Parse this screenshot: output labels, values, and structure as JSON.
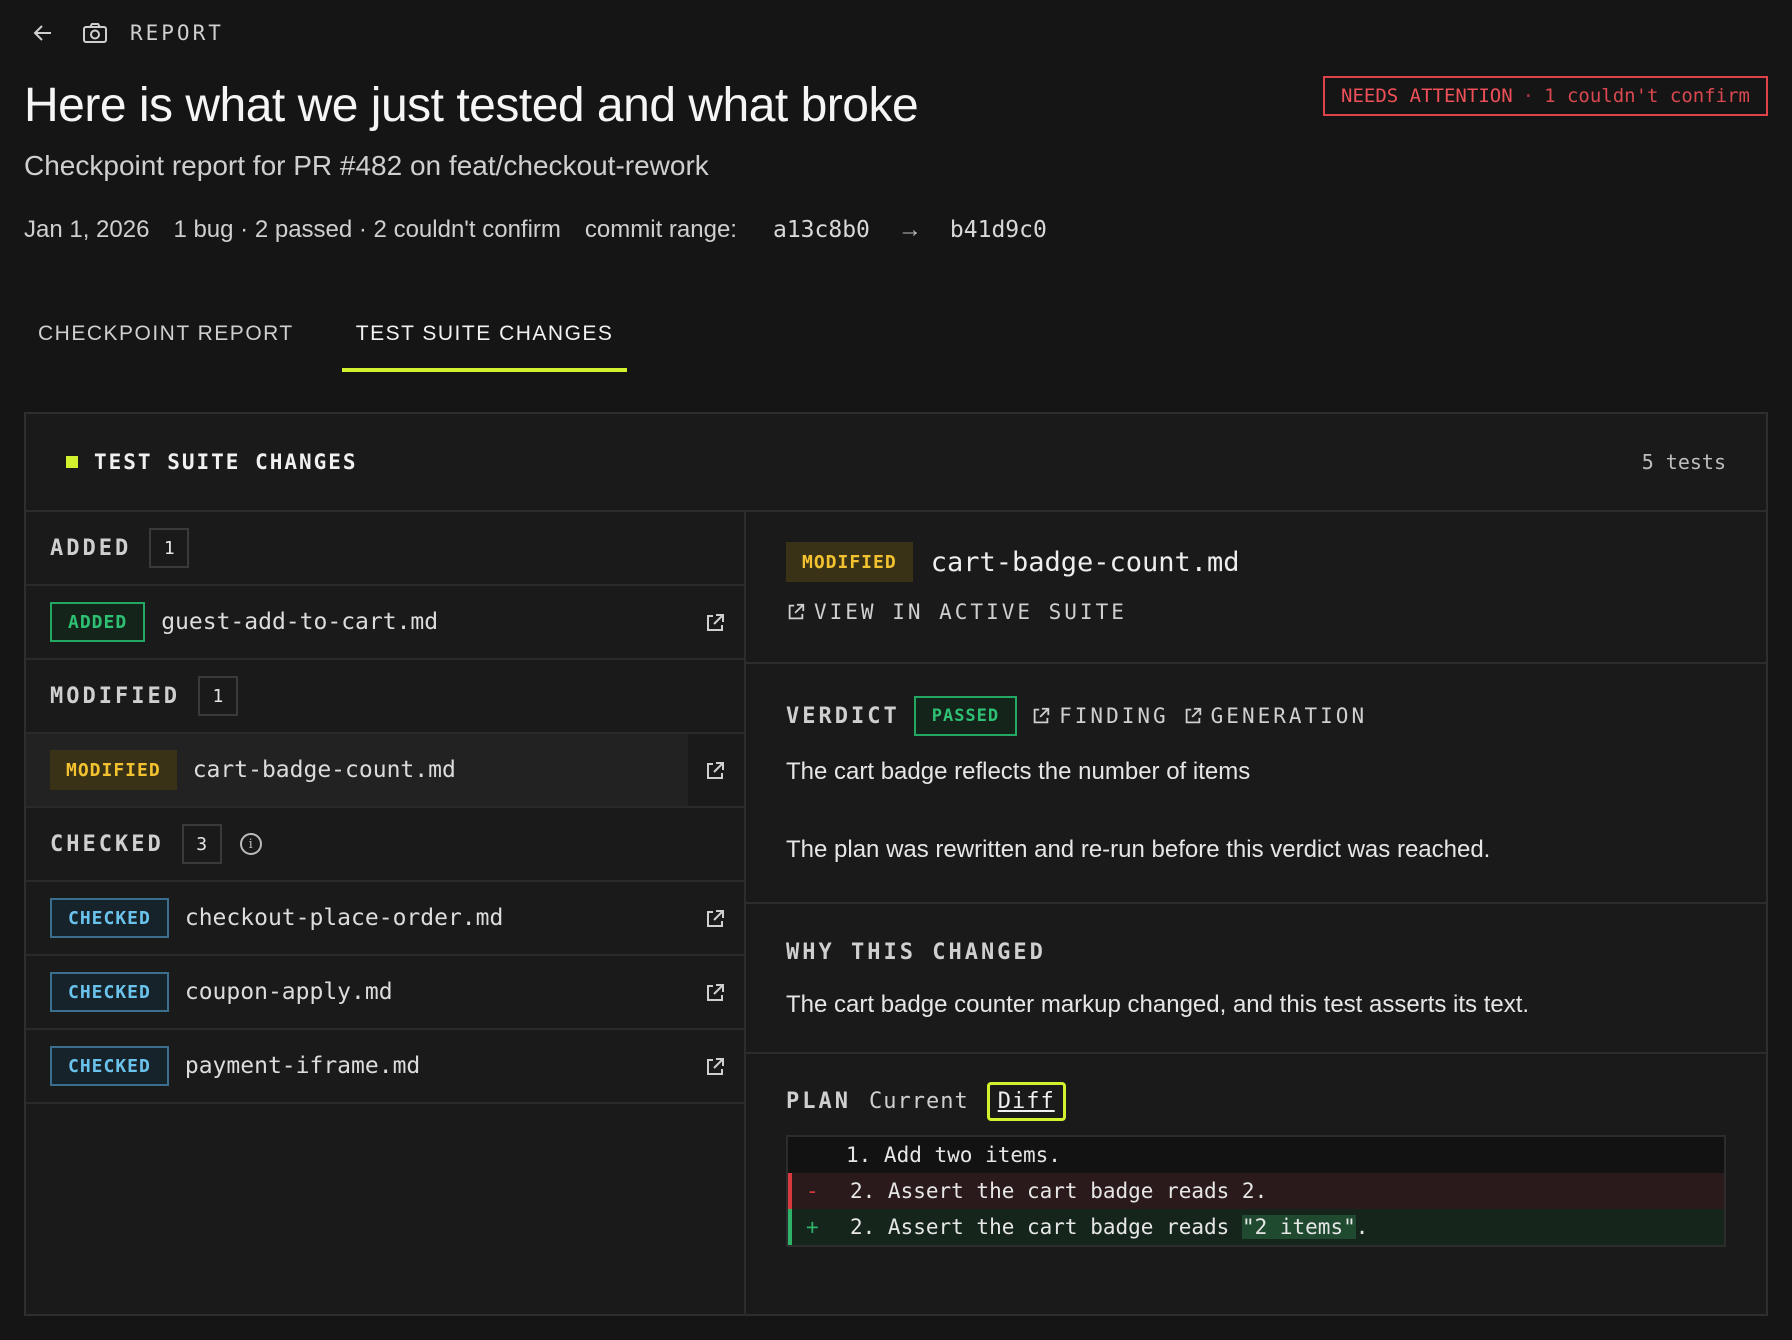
{
  "topbar": {
    "label": "REPORT"
  },
  "header": {
    "title": "Here is what we just tested and what broke",
    "subtitle": "Checkpoint report for PR #482 on feat/checkout-rework",
    "date": "Jan 1, 2026",
    "summary": "1 bug · 2 passed · 2 couldn't confirm",
    "commit_label": "commit range:",
    "commit_from": "a13c8b0",
    "commit_arrow": "→",
    "commit_to": "b41d9c0",
    "status": {
      "label": "NEEDS ATTENTION",
      "sep": "·",
      "detail": "1 couldn't confirm",
      "color": "#e0424a"
    }
  },
  "tabs": [
    {
      "label": "CHECKPOINT REPORT",
      "active": false
    },
    {
      "label": "TEST SUITE CHANGES",
      "active": true
    }
  ],
  "accent": "#d3f22e",
  "panel": {
    "title": "TEST SUITE CHANGES",
    "count": "5 tests",
    "groups": [
      {
        "label": "ADDED",
        "count": "1",
        "items": [
          {
            "badge": "ADDED",
            "name": "guest-add-to-cart.md"
          }
        ]
      },
      {
        "label": "MODIFIED",
        "count": "1",
        "items": [
          {
            "badge": "MODIFIED",
            "name": "cart-badge-count.md",
            "selected": true
          }
        ]
      },
      {
        "label": "CHECKED",
        "count": "3",
        "items": [
          {
            "badge": "CHECKED",
            "name": "checkout-place-order.md"
          },
          {
            "badge": "CHECKED",
            "name": "coupon-apply.md"
          },
          {
            "badge": "CHECKED",
            "name": "payment-iframe.md"
          }
        ]
      }
    ]
  },
  "detail": {
    "badge": "MODIFIED",
    "filename": "cart-badge-count.md",
    "view_link": "VIEW IN ACTIVE SUITE",
    "verdict_label": "VERDICT",
    "verdict": "PASSED",
    "finding_link": "FINDING",
    "generation_link": "GENERATION",
    "verdict_text": "The cart badge reflects the number of items",
    "rerun_text": "The plan was rewritten and re-run before this verdict was reached.",
    "why_label": "WHY THIS CHANGED",
    "why_text": "The cart badge counter markup changed, and this test asserts its text.",
    "plan_label": "PLAN",
    "plan_current": "Current",
    "plan_diff": "Diff",
    "diff_lines": [
      {
        "marker": "",
        "text": "1. Add two items."
      },
      {
        "marker": "-",
        "text": "2. Assert the cart badge reads 2."
      },
      {
        "marker": "+",
        "text_before": "2. Assert the cart badge reads ",
        "text_hl": "\"2 items\"",
        "text_after": "."
      }
    ]
  }
}
